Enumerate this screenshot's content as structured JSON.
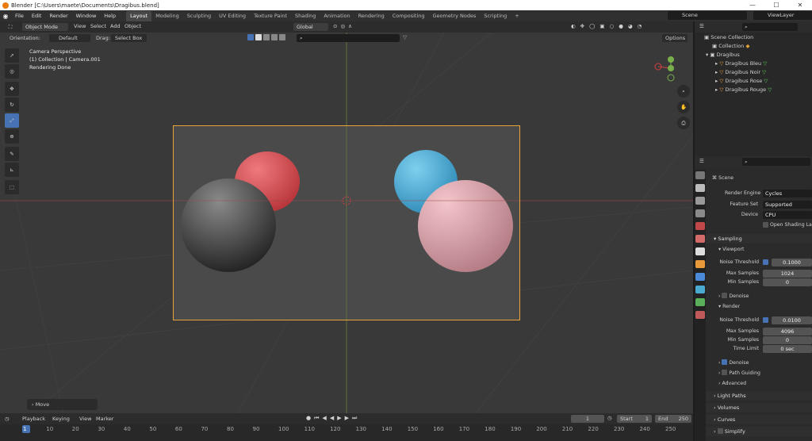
{
  "title": {
    "text": "Blender [C:\\Users\\maete\\Documents\\Dragibus.blend]",
    "min": "—",
    "max": "☐",
    "close": "✕"
  },
  "menu": {
    "file": "File",
    "edit": "Edit",
    "render": "Render",
    "window": "Window",
    "help": "Help"
  },
  "workspaces": [
    "Layout",
    "Modeling",
    "Sculpting",
    "UV Editing",
    "Texture Paint",
    "Shading",
    "Animation",
    "Rendering",
    "Compositing",
    "Geometry Nodes",
    "Scripting",
    "+"
  ],
  "scene_field": "Scene",
  "viewlayer_field": "ViewLayer",
  "viewport_header": {
    "mode": "Object Mode",
    "view": "View",
    "select": "Select",
    "add": "Add",
    "object": "Object",
    "transform": "Global"
  },
  "tool_header": {
    "orientation_label": "Orientation:",
    "orientation": "Default",
    "drag_label": "Drag:",
    "drag": "Select Box",
    "options": "Options"
  },
  "overlay": {
    "line1": "Camera Perspective",
    "line2": "(1) Collection | Camera.001",
    "line3": "Rendering Done"
  },
  "gizmo": {
    "x": "X",
    "y": "Y",
    "z": "Z"
  },
  "move_panel": "Move",
  "timeline": {
    "playback": "Playback",
    "keying": "Keying",
    "view": "View",
    "marker": "Marker",
    "current": "1",
    "start_label": "Start",
    "start": "1",
    "end_label": "End",
    "end": "250",
    "frames": [
      "1",
      "10",
      "20",
      "30",
      "40",
      "50",
      "60",
      "70",
      "80",
      "90",
      "100",
      "110",
      "120",
      "130",
      "140",
      "150",
      "160",
      "170",
      "180",
      "190",
      "200",
      "210",
      "220",
      "230",
      "240",
      "250"
    ]
  },
  "outliner": {
    "scene_collection": "Scene Collection",
    "collection": "Collection",
    "dragibus": "Dragibus",
    "children": [
      "Dragibus Bleu",
      "Dragibus Noir",
      "Dragibus Rose",
      "Dragibus Rouge"
    ]
  },
  "properties": {
    "scene": "Scene",
    "render_engine_label": "Render Engine",
    "render_engine": "Cycles",
    "feature_set_label": "Feature Set",
    "feature_set": "Supported",
    "device_label": "Device",
    "device": "CPU",
    "osl": "Open Shading Langu",
    "sampling": "Sampling",
    "viewport": "Viewport",
    "vp_noise_label": "Noise Threshold",
    "vp_noise": "0.1000",
    "vp_max_label": "Max Samples",
    "vp_max": "1024",
    "vp_min_label": "Min Samples",
    "vp_min": "0",
    "denoise": "Denoise",
    "render": "Render",
    "r_noise_label": "Noise Threshold",
    "r_noise": "0.0100",
    "r_max_label": "Max Samples",
    "r_max": "4096",
    "r_min_label": "Min Samples",
    "r_min": "0",
    "time_limit_label": "Time Limit",
    "time_limit": "0 sec",
    "denoise2": "Denoise",
    "path_guiding": "Path Guiding",
    "advanced": "Advanced",
    "light_paths": "Light Paths",
    "volumes": "Volumes",
    "curves": "Curves",
    "simplify": "Simplify"
  },
  "colors": {
    "accent": "#4772b3",
    "camera_frame": "#e8a33a",
    "blue": "#45a8d6",
    "red": "#d84a4f",
    "pink": "#dca0a8",
    "black": "#3a3a3a"
  }
}
